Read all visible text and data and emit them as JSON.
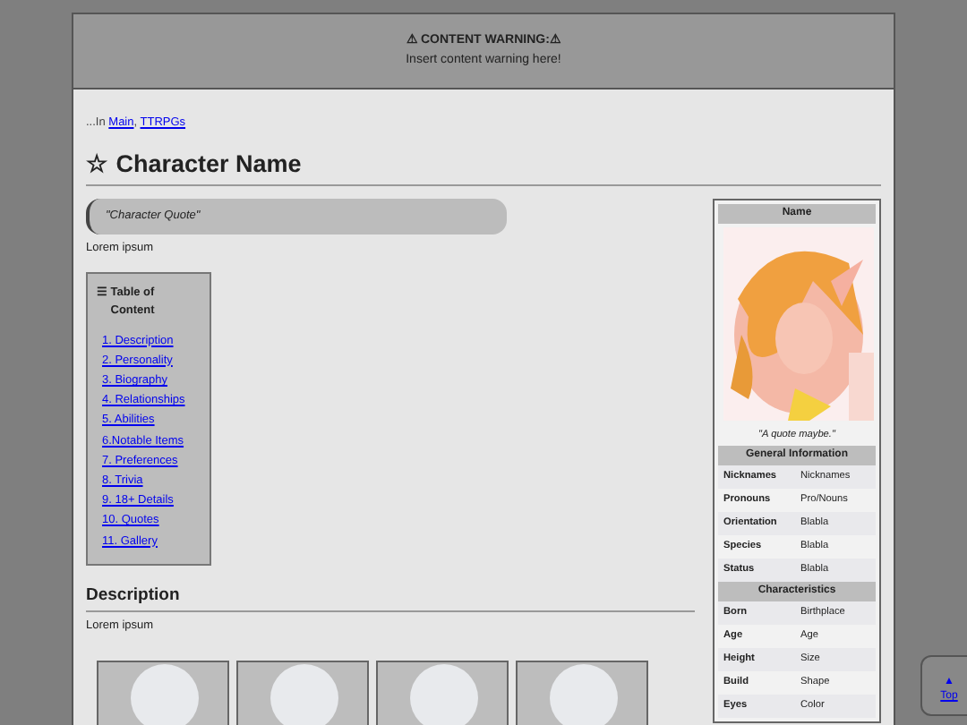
{
  "warning": {
    "title": "⚠ CONTENT WARNING:⚠",
    "text": "Insert content warning here!"
  },
  "breadcrumb": {
    "prefix": "...In",
    "links": [
      "Main",
      "TTRPGs"
    ],
    "separator": ","
  },
  "page_title": {
    "icon": "☆",
    "text": "Character Name"
  },
  "quote": "\"Character Quote\"",
  "intro": "Lorem ipsum",
  "toc": {
    "icon": "☰",
    "title": "Table of Content",
    "items": [
      "1. Description",
      "2. Personality",
      "3. Biography",
      "4. Relationships",
      "5. Abilities",
      "6.Notable Items",
      "7. Preferences",
      "8. Trivia",
      "9. 18+ Details",
      "10. Quotes",
      "11. Gallery"
    ]
  },
  "section": {
    "title": "Description",
    "text": "Lorem ipsum"
  },
  "infobox": {
    "name": "Name",
    "caption": "\"A quote maybe.\"",
    "groups": [
      {
        "title": "General Information",
        "rows": [
          [
            "Nicknames",
            "Nicknames"
          ],
          [
            "Pronouns",
            "Pro/Nouns"
          ],
          [
            "Orientation",
            "Blabla"
          ],
          [
            "Species",
            "Blabla"
          ],
          [
            "Status",
            "Blabla"
          ]
        ]
      },
      {
        "title": "Characteristics",
        "rows": [
          [
            "Born",
            "Birthplace"
          ],
          [
            "Age",
            "Age"
          ],
          [
            "Height",
            "Size"
          ],
          [
            "Build",
            "Shape"
          ],
          [
            "Eyes",
            "Color"
          ]
        ]
      }
    ]
  },
  "top_button": {
    "icon": "▲",
    "label": "Top"
  }
}
